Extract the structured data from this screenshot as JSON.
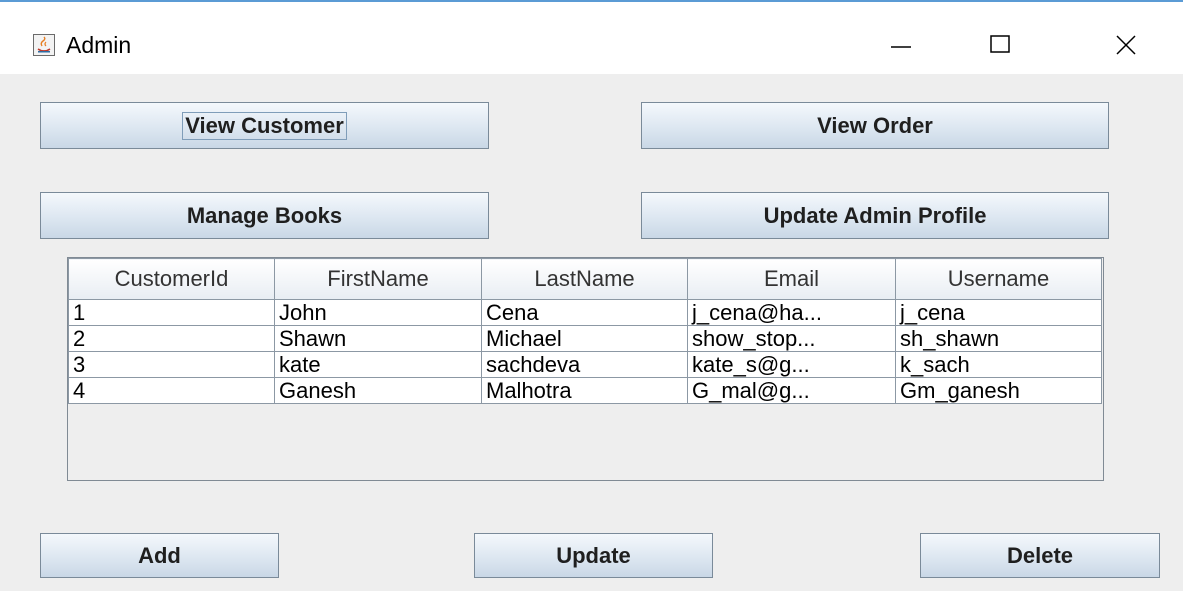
{
  "window": {
    "title": "Admin",
    "controls": {
      "minimize": "—",
      "maximize": "☐",
      "close": "✕"
    }
  },
  "buttons": {
    "view_customer": "View Customer",
    "view_order": "View Order",
    "manage_books": "Manage Books",
    "update_admin_profile": "Update Admin Profile",
    "add": "Add",
    "update": "Update",
    "delete": "Delete"
  },
  "table": {
    "headers": [
      "CustomerId",
      "FirstName",
      "LastName",
      "Email",
      "Username"
    ],
    "rows": [
      [
        "1",
        "John",
        "Cena",
        "j_cena@ha...",
        "j_cena"
      ],
      [
        "2",
        "Shawn",
        "Michael",
        "show_stop...",
        "sh_shawn"
      ],
      [
        "3",
        "kate",
        "sachdeva",
        "kate_s@g...",
        "k_sach"
      ],
      [
        "4",
        "Ganesh",
        "Malhotra",
        "G_mal@g...",
        "Gm_ganesh"
      ]
    ]
  },
  "colors": {
    "window_bg": "#eeeeee",
    "title_border": "#5b9bd5",
    "button_border": "#7a8a99"
  }
}
